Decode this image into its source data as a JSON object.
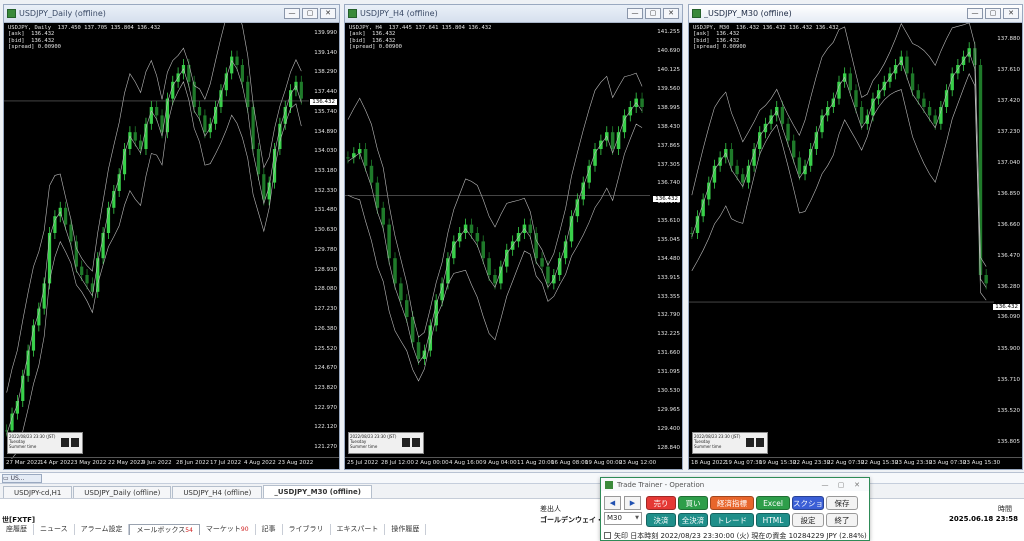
{
  "windows": [
    {
      "title": "USDJPY_Daily (offline)",
      "info": [
        "USDJPY, Daily  137.450 137.705 135.804 136.432",
        "[ask]  136.432",
        "[bid]  136.432",
        "[spread] 0.00900"
      ],
      "price_ticks": [
        "139.990",
        "139.140",
        "138.290",
        "137.440",
        "135.740",
        "134.890",
        "134.030",
        "133.180",
        "132.330",
        "131.480",
        "130.630",
        "129.780",
        "128.930",
        "128.080",
        "127.230",
        "126.380",
        "125.520",
        "124.670",
        "123.820",
        "122.970",
        "122.120",
        "121.270"
      ],
      "current_price": "136.432",
      "time_ticks": [
        "27 Mar 2022",
        "14 Apr 2022",
        "3 May 2022",
        "22 May 2022",
        "9 Jun 2022",
        "28 Jun 2022",
        "17 Jul 2022",
        "4 Aug 2022",
        "23 Aug 2022"
      ],
      "mini_panel": [
        "2022/08/23 23:30 (JST)",
        "Tuesday",
        "Summer time"
      ]
    },
    {
      "title": "USDJPY_H4 (offline)",
      "info": [
        "USDJPY, H4  137.445 137.641 135.804 136.432",
        "[ask]  136.432",
        "[bid]  136.432",
        "[spread] 0.00900"
      ],
      "price_ticks": [
        "141.255",
        "140.690",
        "140.125",
        "139.560",
        "138.995",
        "138.430",
        "137.865",
        "137.305",
        "136.740",
        "136.175",
        "135.610",
        "135.045",
        "134.480",
        "133.915",
        "133.355",
        "132.790",
        "132.225",
        "131.660",
        "131.095",
        "130.530",
        "129.965",
        "129.400",
        "128.840"
      ],
      "current_price": "136.432",
      "time_ticks": [
        "25 Jul 2022",
        "28 Jul 12:00",
        "2 Aug 00:00",
        "4 Aug 16:00",
        "9 Aug 04:00",
        "11 Aug 20:00",
        "16 Aug 08:00",
        "19 Aug 00:00",
        "23 Aug 12:00"
      ],
      "mini_panel": [
        "2022/08/23 23:30 (JST)",
        "Tuesday",
        "Summer time"
      ]
    },
    {
      "title": "_USDJPY_M30 (offline)",
      "info": [
        "USDJPY, M30  136.432 136.432 136.432 136.432",
        "[ask]  136.432",
        "[bid]  136.432",
        "[spread] 0.00900"
      ],
      "price_ticks": [
        "137.880",
        "137.610",
        "137.420",
        "137.230",
        "137.040",
        "136.850",
        "136.660",
        "136.470",
        "136.280",
        "136.090",
        "135.900",
        "135.710",
        "135.520",
        "135.805"
      ],
      "current_price": "136.432",
      "time_ticks": [
        "18 Aug 2022",
        "19 Aug 07:30",
        "19 Aug 15:30",
        "22 Aug 23:30",
        "22 Aug 07:30",
        "22 Aug 15:30",
        "23 Aug 23:30",
        "23 Aug 07:30",
        "23 Aug 15:30"
      ],
      "mini_panel": [
        "2022/08/23 23:30 (JST)",
        "Tuesday",
        "Summer time"
      ]
    }
  ],
  "window_tabs": [
    "USDJPY-cd,H1",
    "USDJPY_Daily (offline)",
    "USDJPY_H4 (offline)",
    "_USDJPY_M30 (offline)"
  ],
  "terminal": {
    "col_issuer": "差出人",
    "col_time": "時間",
    "left_label": "世[FXTF]",
    "issuer_value": "ゴールデンウェイ・ジャパ",
    "date_value": "2025.06.18 23:58"
  },
  "bottom_tabs": [
    {
      "label": "座履歴"
    },
    {
      "label": "ニュース"
    },
    {
      "label": "アラーム設定"
    },
    {
      "label": "メールボックス",
      "badge": "54"
    },
    {
      "label": "マーケット",
      "badge": "90"
    },
    {
      "label": "記事"
    },
    {
      "label": "ライブラリ"
    },
    {
      "label": "エキスパート"
    },
    {
      "label": "操作履歴"
    }
  ],
  "trade_trainer": {
    "title": "Trade Trainer - Operation",
    "timeframe": "M30",
    "buttons": {
      "sell": "売り",
      "buy": "買い",
      "econ": "経済指標",
      "excel": "Excel",
      "screenshot": "スクショ",
      "save": "保存",
      "settle": "決済",
      "settle_all": "全決済",
      "trend": "トレード",
      "html": "HTML",
      "settings": "設定",
      "exit": "終了"
    },
    "status": "矢印  日本時刻 2022/08/23 23:30:00 (火)   現在の資金 10284229 JPY (2.84%)"
  },
  "colors": {
    "bull": "#39d04a",
    "bear": "#1f7a2a",
    "band": "#bbbbbb",
    "background": "#000000"
  }
}
